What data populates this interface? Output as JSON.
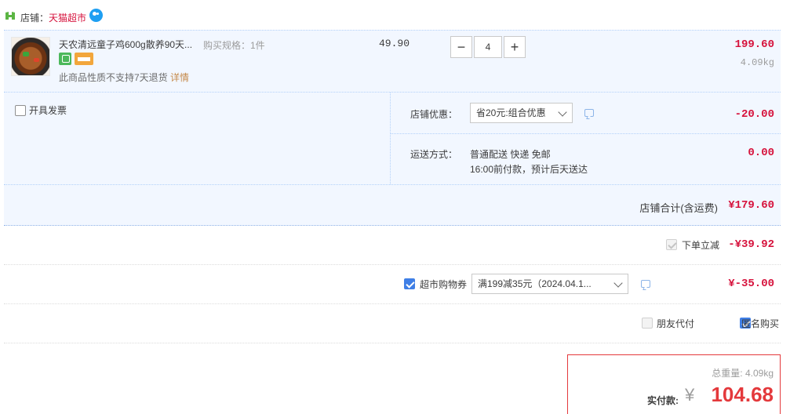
{
  "shop": {
    "label": "店铺：",
    "name": "天猫超市"
  },
  "item": {
    "title": "天农清远童子鸡600g散养90天...",
    "spec": "购买规格：1件",
    "return_note": "此商品性质不支持7天退货",
    "return_link": "详情",
    "unit_price": "49.90",
    "quantity": "4",
    "minus_label": "−",
    "plus_label": "+",
    "sum": "199.60",
    "weight": "4.09kg"
  },
  "invoice": {
    "label": "开具发票"
  },
  "promo": {
    "label": "店铺优惠：",
    "selected": "省20元:组合优惠",
    "amount": "-20.00"
  },
  "shipping": {
    "label": "运送方式：",
    "line1": "普通配送 快递 免邮",
    "line2": "16:00前付款，预计后天送达",
    "amount": "0.00"
  },
  "store_total": {
    "label": "店铺合计(含运费)",
    "amount": "¥179.60"
  },
  "instant_discount": {
    "label": "下单立减",
    "amount": "-¥39.92"
  },
  "coupon": {
    "label": "超市购物券",
    "selected": "满199减35元（2024.04.1...",
    "amount": "¥-35.00"
  },
  "options": {
    "friend_pay_label": "朋友代付",
    "anonymous_label": "匿名购买"
  },
  "payment": {
    "weight_total": "总重量: 4.09kg",
    "label": "实付款:",
    "currency": "¥",
    "amount": "104.68"
  },
  "colors": {
    "accent_red": "#d6123c",
    "checkbox_blue": "#3f7fe6",
    "row_bg": "#f2f7ff"
  }
}
